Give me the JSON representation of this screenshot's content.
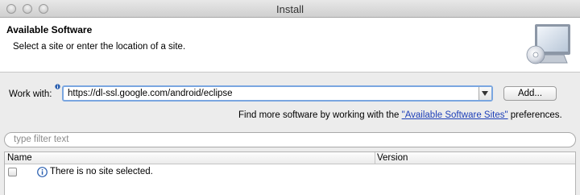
{
  "window": {
    "title": "Install"
  },
  "header": {
    "title": "Available Software",
    "description": "Select a site or enter the location of a site."
  },
  "work_with": {
    "label": "Work with:",
    "value": "https://dl-ssl.google.com/android/eclipse",
    "add_label": "Add..."
  },
  "find_more": {
    "prefix": "Find more software by working with the ",
    "link": "\"Available Software Sites\"",
    "suffix": " preferences."
  },
  "filter": {
    "placeholder": "type filter text"
  },
  "table": {
    "columns": [
      "Name",
      "Version"
    ],
    "message": "There is no site selected."
  },
  "colors": {
    "link": "#1d3fb8",
    "focus_ring": "#7aa6e0",
    "info": "#2a5fb0"
  }
}
